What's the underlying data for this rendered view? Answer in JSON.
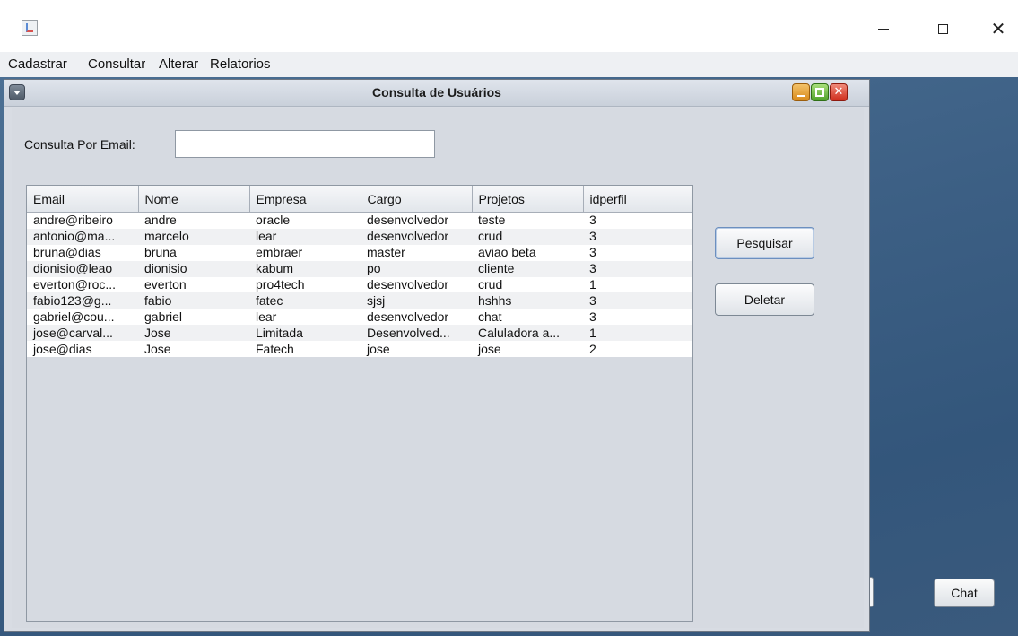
{
  "window": {
    "minimize_glyph": "—",
    "maximize_glyph": "☐",
    "close_glyph": "✕"
  },
  "menubar": {
    "items": [
      "Cadastrar",
      "Consultar",
      "Alterar",
      "Relatorios"
    ]
  },
  "internal_frame": {
    "title": "Consulta de Usuários",
    "close_glyph": "✕"
  },
  "form": {
    "email_label": "Consulta Por Email:",
    "email_value": "",
    "email_placeholder": ""
  },
  "table": {
    "columns": [
      "Email",
      "Nome",
      "Empresa",
      "Cargo",
      "Projetos",
      "idperfil"
    ],
    "rows": [
      [
        "andre@ribeiro",
        "andre",
        "oracle",
        "desenvolvedor",
        "teste",
        "3"
      ],
      [
        "antonio@ma...",
        "marcelo",
        "lear",
        "desenvolvedor",
        "crud",
        "3"
      ],
      [
        "bruna@dias",
        "bruna",
        "embraer",
        "master",
        "aviao beta",
        "3"
      ],
      [
        "dionisio@leao",
        "dionisio",
        "kabum",
        "po",
        "cliente",
        "3"
      ],
      [
        "everton@roc...",
        "everton",
        "pro4tech",
        "desenvolvedor",
        "crud",
        "1"
      ],
      [
        "fabio123@g...",
        "fabio",
        "fatec",
        "sjsj",
        "hshhs",
        "3"
      ],
      [
        "gabriel@cou...",
        "gabriel",
        "lear",
        "desenvolvedor",
        "chat",
        "3"
      ],
      [
        "jose@carval...",
        "Jose",
        "Limitada",
        "Desenvolved...",
        "Caluladora a...",
        "1"
      ],
      [
        "jose@dias",
        "Jose",
        "Fatech",
        "jose",
        "jose",
        "2"
      ]
    ]
  },
  "buttons": {
    "search": "Pesquisar",
    "delete": "Deletar",
    "chat": "Chat"
  },
  "colors": {
    "desktop": "#3f6389",
    "frame_bg": "#d6dae1"
  }
}
